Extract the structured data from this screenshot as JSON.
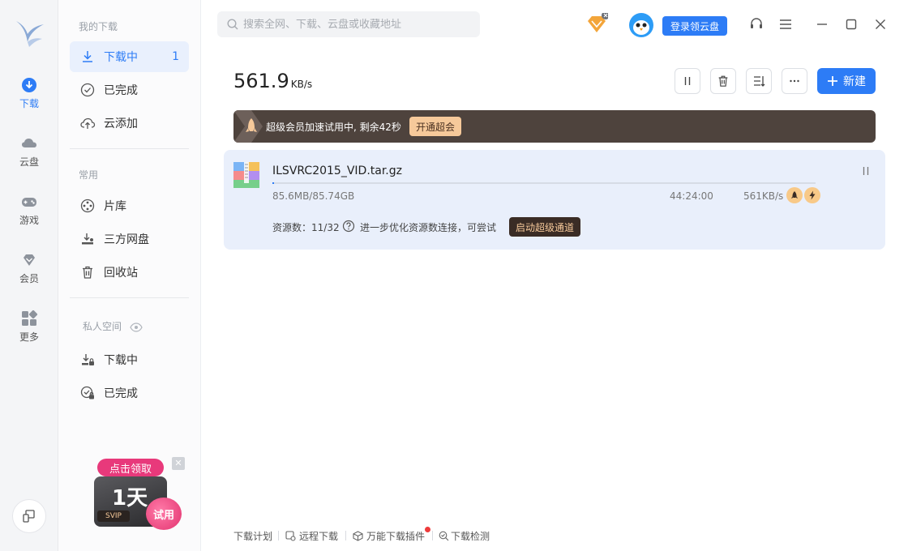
{
  "rail": {
    "items": [
      {
        "label": "下载"
      },
      {
        "label": "云盘"
      },
      {
        "label": "游戏"
      },
      {
        "label": "会员"
      },
      {
        "label": "更多"
      }
    ]
  },
  "nav": {
    "section_mine": "我的下载",
    "downloading": "下载中",
    "downloading_count": "1",
    "completed": "已完成",
    "cloud_add": "云添加",
    "section_common": "常用",
    "library": "片库",
    "third_party": "三方网盘",
    "recycle": "回收站",
    "section_private": "私人空间",
    "private_downloading": "下载中",
    "private_completed": "已完成"
  },
  "promo": {
    "ribbon": "点击领取",
    "days": "1天",
    "svip": "SVIP",
    "trial": "试用"
  },
  "search": {
    "placeholder": "搜索全网、下载、云盘或收藏地址"
  },
  "header": {
    "login_button": "登录领云盘"
  },
  "speed": {
    "value": "561.9",
    "unit": "KB/s"
  },
  "toolbar": {
    "new_button": "新建"
  },
  "banner": {
    "text": "超级会员加速试用中, 剩余42秒",
    "button": "开通超会"
  },
  "task": {
    "file_name": "ILSVRC2015_VID.tar.gz",
    "size": "85.6MB/85.74GB",
    "progress_fraction": 0.001,
    "eta": "44:24:00",
    "rate": "561KB/s",
    "sources": "资源数：11/32",
    "hint": "进一步优化资源数连接，可尝试",
    "boost_button": "启动超级通道"
  },
  "footer": {
    "plan": "下载计划",
    "remote": "远程下载",
    "plugin": "万能下载插件",
    "check": "下载检测"
  },
  "colors": {
    "accent": "#2d7cf6",
    "banner_bg": "#4e433d",
    "gold": "#f6c99a"
  }
}
